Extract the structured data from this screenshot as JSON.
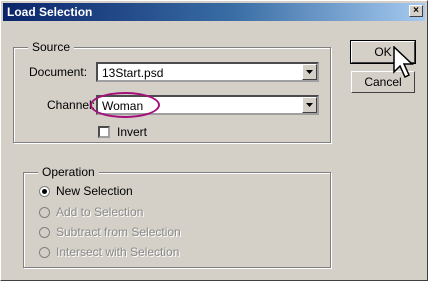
{
  "dialog": {
    "title": "Load Selection"
  },
  "source": {
    "legend": "Source",
    "document_label": "Document:",
    "document_value": "13Start.psd",
    "channel_label": "Channel:",
    "channel_value": "Woman",
    "invert_label": "Invert",
    "invert_checked": false
  },
  "operation": {
    "legend": "Operation",
    "options": [
      {
        "label": "New Selection",
        "selected": true,
        "enabled": true
      },
      {
        "label": "Add to Selection",
        "selected": false,
        "enabled": false
      },
      {
        "label": "Subtract from Selection",
        "selected": false,
        "enabled": false
      },
      {
        "label": "Intersect with Selection",
        "selected": false,
        "enabled": false
      }
    ]
  },
  "buttons": {
    "ok": "OK",
    "cancel": "Cancel"
  },
  "colors": {
    "title_bar": "#0a246a",
    "highlight_ellipse": "#a3127a",
    "dialog_bg": "#d4d0c8"
  },
  "icons": [
    "close-icon",
    "dropdown-arrow-icon",
    "mouse-pointer-icon"
  ]
}
